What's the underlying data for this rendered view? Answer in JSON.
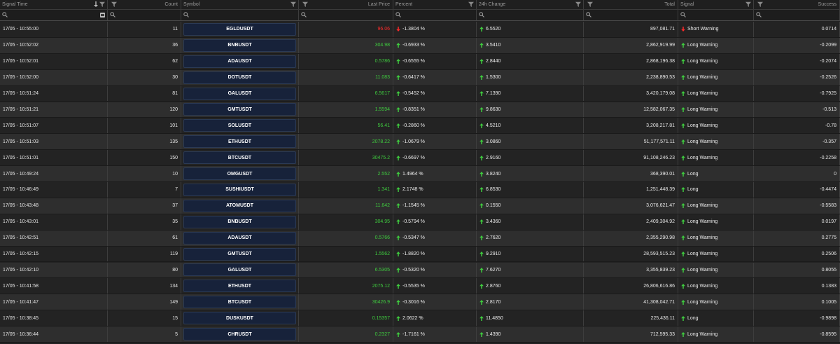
{
  "columns": [
    {
      "key": "time",
      "label": "Signal Time",
      "align": "left"
    },
    {
      "key": "count",
      "label": "Count",
      "align": "right"
    },
    {
      "key": "symbol",
      "label": "Symbol",
      "align": "left"
    },
    {
      "key": "price",
      "label": "Last Price",
      "align": "right"
    },
    {
      "key": "percent",
      "label": "Percent",
      "align": "left"
    },
    {
      "key": "change",
      "label": "24h Change",
      "align": "left"
    },
    {
      "key": "total",
      "label": "Total",
      "align": "right"
    },
    {
      "key": "signal",
      "label": "Signal",
      "align": "left"
    },
    {
      "key": "success",
      "label": "Success",
      "align": "right"
    }
  ],
  "colors": {
    "up": "#3fcb3f",
    "down": "#ff2a2a",
    "symbol_bg": "#17223a"
  },
  "icons": {
    "filter": "filter-icon",
    "search": "search-icon",
    "sort": "sort-desc-icon",
    "calendar": "calendar-icon",
    "up": "arrow-up-icon",
    "down": "arrow-down-icon"
  },
  "rows": [
    {
      "time": "17/05 - 10:55:00",
      "count": "11",
      "symbol": "EGLDUSDT",
      "price": "96.06",
      "price_dir": "down",
      "percent": "-1.3804 %",
      "percent_dir": "down",
      "change": "6.5520",
      "change_dir": "up",
      "total": "897,081.71",
      "signal": "Short Warning",
      "signal_dir": "down",
      "success": "0.0714"
    },
    {
      "time": "17/05 - 10:52:02",
      "count": "36",
      "symbol": "BNBUSDT",
      "price": "304.98",
      "price_dir": "up",
      "percent": "-0.6933 %",
      "percent_dir": "up",
      "change": "3.5410",
      "change_dir": "up",
      "total": "2,862,919.99",
      "signal": "Long Warning",
      "signal_dir": "up",
      "success": "-0.2099"
    },
    {
      "time": "17/05 - 10:52:01",
      "count": "62",
      "symbol": "ADAUSDT",
      "price": "0.5786",
      "price_dir": "up",
      "percent": "-0.6555 %",
      "percent_dir": "up",
      "change": "2.8440",
      "change_dir": "up",
      "total": "2,868,196.38",
      "signal": "Long Warning",
      "signal_dir": "up",
      "success": "-0.2074"
    },
    {
      "time": "17/05 - 10:52:00",
      "count": "30",
      "symbol": "DOTUSDT",
      "price": "11.083",
      "price_dir": "up",
      "percent": "-0.6417 %",
      "percent_dir": "up",
      "change": "1.5300",
      "change_dir": "up",
      "total": "2,238,890.53",
      "signal": "Long Warning",
      "signal_dir": "up",
      "success": "-0.2526"
    },
    {
      "time": "17/05 - 10:51:24",
      "count": "81",
      "symbol": "GALUSDT",
      "price": "6.5617",
      "price_dir": "up",
      "percent": "-0.5452 %",
      "percent_dir": "up",
      "change": "7.1390",
      "change_dir": "up",
      "total": "3,420,179.08",
      "signal": "Long Warning",
      "signal_dir": "up",
      "success": "-0.7925"
    },
    {
      "time": "17/05 - 10:51:21",
      "count": "120",
      "symbol": "GMTUSDT",
      "price": "1.5594",
      "price_dir": "up",
      "percent": "-0.8351 %",
      "percent_dir": "up",
      "change": "9.8630",
      "change_dir": "up",
      "total": "12,582,067.35",
      "signal": "Long Warning",
      "signal_dir": "up",
      "success": "-0.513"
    },
    {
      "time": "17/05 - 10:51:07",
      "count": "101",
      "symbol": "SOLUSDT",
      "price": "56.41",
      "price_dir": "up",
      "percent": "-0.2860 %",
      "percent_dir": "up",
      "change": "4.5210",
      "change_dir": "up",
      "total": "3,208,217.81",
      "signal": "Long Warning",
      "signal_dir": "up",
      "success": "-0.78"
    },
    {
      "time": "17/05 - 10:51:03",
      "count": "135",
      "symbol": "ETHUSDT",
      "price": "2078.22",
      "price_dir": "up",
      "percent": "-1.0679 %",
      "percent_dir": "up",
      "change": "3.0860",
      "change_dir": "up",
      "total": "51,177,571.11",
      "signal": "Long Warning",
      "signal_dir": "up",
      "success": "-0.357"
    },
    {
      "time": "17/05 - 10:51:01",
      "count": "150",
      "symbol": "BTCUSDT",
      "price": "30475.2",
      "price_dir": "up",
      "percent": "-0.6697 %",
      "percent_dir": "up",
      "change": "2.9160",
      "change_dir": "up",
      "total": "91,108,246.23",
      "signal": "Long Warning",
      "signal_dir": "up",
      "success": "-0.2258"
    },
    {
      "time": "17/05 - 10:49:24",
      "count": "10",
      "symbol": "OMGUSDT",
      "price": "2.552",
      "price_dir": "up",
      "percent": "1.4964 %",
      "percent_dir": "up",
      "change": "3.8240",
      "change_dir": "up",
      "total": "368,390.01",
      "signal": "Long",
      "signal_dir": "up",
      "success": "0"
    },
    {
      "time": "17/05 - 10:46:49",
      "count": "7",
      "symbol": "SUSHIUSDT",
      "price": "1.341",
      "price_dir": "up",
      "percent": "2.1748 %",
      "percent_dir": "up",
      "change": "6.8530",
      "change_dir": "up",
      "total": "1,251,448.39",
      "signal": "Long",
      "signal_dir": "up",
      "success": "-0.4474"
    },
    {
      "time": "17/05 - 10:43:48",
      "count": "37",
      "symbol": "ATOMUSDT",
      "price": "11.642",
      "price_dir": "up",
      "percent": "-1.1545 %",
      "percent_dir": "up",
      "change": "0.1550",
      "change_dir": "up",
      "total": "3,076,621.47",
      "signal": "Long Warning",
      "signal_dir": "up",
      "success": "-0.5583"
    },
    {
      "time": "17/05 - 10:43:01",
      "count": "35",
      "symbol": "BNBUSDT",
      "price": "304.95",
      "price_dir": "up",
      "percent": "-0.5794 %",
      "percent_dir": "up",
      "change": "3.4360",
      "change_dir": "up",
      "total": "2,409,304.92",
      "signal": "Long Warning",
      "signal_dir": "up",
      "success": "0.0197"
    },
    {
      "time": "17/05 - 10:42:51",
      "count": "61",
      "symbol": "ADAUSDT",
      "price": "0.5766",
      "price_dir": "up",
      "percent": "-0.5347 %",
      "percent_dir": "up",
      "change": "2.7620",
      "change_dir": "up",
      "total": "2,355,290.98",
      "signal": "Long Warning",
      "signal_dir": "up",
      "success": "0.2775"
    },
    {
      "time": "17/05 - 10:42:15",
      "count": "119",
      "symbol": "GMTUSDT",
      "price": "1.5562",
      "price_dir": "up",
      "percent": "-1.8820 %",
      "percent_dir": "up",
      "change": "9.2910",
      "change_dir": "up",
      "total": "28,593,515.23",
      "signal": "Long Warning",
      "signal_dir": "up",
      "success": "0.2506"
    },
    {
      "time": "17/05 - 10:42:10",
      "count": "80",
      "symbol": "GALUSDT",
      "price": "6.5305",
      "price_dir": "up",
      "percent": "-0.5320 %",
      "percent_dir": "up",
      "change": "7.6270",
      "change_dir": "up",
      "total": "3,355,839.23",
      "signal": "Long Warning",
      "signal_dir": "up",
      "success": "0.8055"
    },
    {
      "time": "17/05 - 10:41:58",
      "count": "134",
      "symbol": "ETHUSDT",
      "price": "2075.12",
      "price_dir": "up",
      "percent": "-0.5535 %",
      "percent_dir": "up",
      "change": "2.8760",
      "change_dir": "up",
      "total": "26,806,616.86",
      "signal": "Long Warning",
      "signal_dir": "up",
      "success": "0.1383"
    },
    {
      "time": "17/05 - 10:41:47",
      "count": "149",
      "symbol": "BTCUSDT",
      "price": "30426.9",
      "price_dir": "up",
      "percent": "-0.3016 %",
      "percent_dir": "up",
      "change": "2.8170",
      "change_dir": "up",
      "total": "41,308,042.71",
      "signal": "Long Warning",
      "signal_dir": "up",
      "success": "0.1005"
    },
    {
      "time": "17/05 - 10:38:45",
      "count": "15",
      "symbol": "DUSKUSDT",
      "price": "0.15357",
      "price_dir": "up",
      "percent": "2.0622 %",
      "percent_dir": "up",
      "change": "11.4850",
      "change_dir": "up",
      "total": "225,436.11",
      "signal": "Long",
      "signal_dir": "up",
      "success": "-0.9898"
    },
    {
      "time": "17/05 - 10:36:44",
      "count": "5",
      "symbol": "CHRUSDT",
      "price": "0.2327",
      "price_dir": "up",
      "percent": "-1.7161 %",
      "percent_dir": "up",
      "change": "1.4390",
      "change_dir": "up",
      "total": "712,595.33",
      "signal": "Long Warning",
      "signal_dir": "up",
      "success": "-0.8595"
    }
  ]
}
